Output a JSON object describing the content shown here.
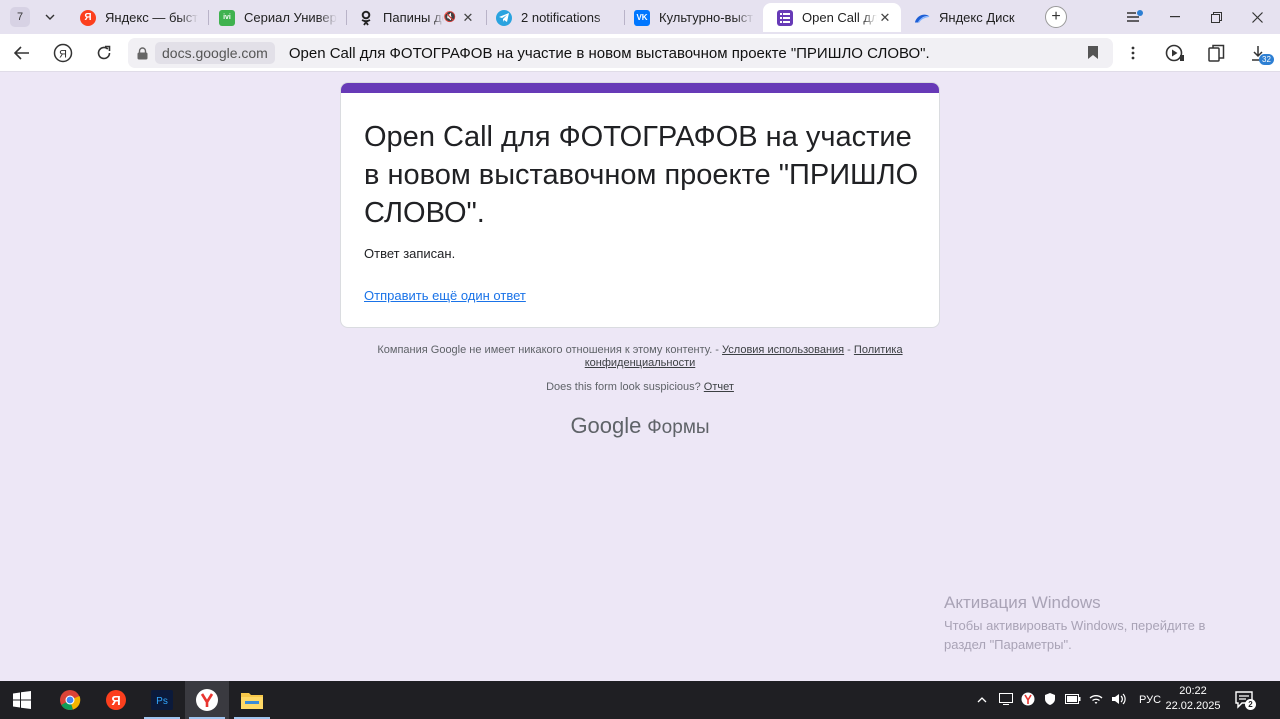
{
  "browser": {
    "tab_count": "7",
    "tabs": [
      {
        "title": "Яндекс — быстрый поиск",
        "icon": "yandex-icon",
        "color": "#fc3f1d",
        "has_close": false
      },
      {
        "title": "Сериал Универ:",
        "icon": "ivi-icon",
        "color": "#3fb24f",
        "has_close": false
      },
      {
        "title": "Папины доч",
        "icon": "okru-icon",
        "color": "#333333",
        "has_close": true
      },
      {
        "title": "2 notifications",
        "icon": "telegram-icon",
        "color": "#2aa3df",
        "has_close": false
      },
      {
        "title": "Культурно-выста",
        "icon": "vk-icon",
        "color": "#0077ff",
        "has_close": false
      },
      {
        "title": "Open Call для",
        "icon": "google-forms-icon",
        "color": "#673ab7",
        "has_close": true,
        "active": true
      },
      {
        "title": "Яндекс Диск",
        "icon": "yandex-disk-icon",
        "color": "#1e5fd6",
        "has_close": false
      }
    ],
    "address": {
      "domain": "docs.google.com",
      "page_title": "Open Call для ФОТОГРАФОВ на участие в новом выставочном проекте \"ПРИШЛО СЛОВО\"."
    },
    "downloads_badge": "32"
  },
  "form": {
    "accent_color": "#673ab7",
    "title": "Open Call для ФОТОГРАФОВ на участие в новом выставочном проекте \"ПРИШЛО СЛОВО\".",
    "confirmation": "Ответ записан.",
    "submit_another": "Отправить ещё один ответ"
  },
  "footer": {
    "disclaimer_text": "Компания Google не имеет никакого отношения к этому контенту. - ",
    "terms_link": "Условия использования",
    "separator": " - ",
    "privacy_link": "Политика конфиденциальности",
    "suspicious_text": "Does this form look suspicious? ",
    "report_link": "Отчет",
    "brand_google": "Google",
    "brand_product": "Формы"
  },
  "windows_activation": {
    "title": "Активация Windows",
    "subtitle": "Чтобы активировать Windows, перейдите в раздел \"Параметры\"."
  },
  "taskbar": {
    "apps": [
      "start-button",
      "chrome-icon",
      "yandex-browser-icon",
      "photoshop-icon",
      "yandex-browser-active-icon",
      "file-explorer-icon"
    ],
    "language": "РУС",
    "time": "20:22",
    "date": "22.02.2025",
    "notification_count": "2"
  }
}
